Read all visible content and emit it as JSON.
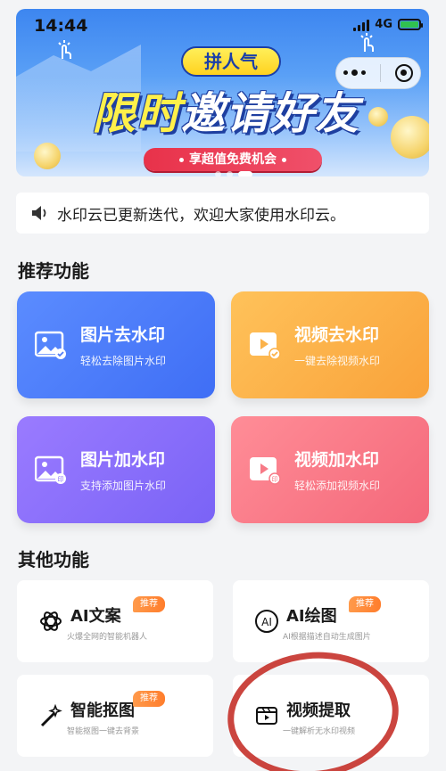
{
  "status_bar": {
    "time": "14:44",
    "network": "4G"
  },
  "banner": {
    "badge": "拼人气",
    "title_highlight": "限时",
    "title_rest": "邀请好友",
    "pill_text": "享超值免费机会"
  },
  "notice": {
    "text": "水印云已更新迭代，欢迎大家使用水印云。"
  },
  "recommended": {
    "title": "推荐功能",
    "cards": [
      {
        "title": "图片去水印",
        "subtitle": "轻松去除图片水印",
        "icon": "image-remove-icon",
        "color": "#4f7df8"
      },
      {
        "title": "视频去水印",
        "subtitle": "一键去除视频水印",
        "icon": "video-remove-icon",
        "color": "#fbb24a"
      },
      {
        "title": "图片加水印",
        "subtitle": "支持添加图片水印",
        "icon": "image-add-icon",
        "color": "#8a6ffb"
      },
      {
        "title": "视频加水印",
        "subtitle": "轻松添加视频水印",
        "icon": "video-add-icon",
        "color": "#f77a87"
      }
    ]
  },
  "other": {
    "title": "其他功能",
    "cards": [
      {
        "title": "AI文案",
        "subtitle": "火爆全网的智能机器人",
        "tag": "推荐",
        "icon": "openai-icon"
      },
      {
        "title": "AI绘图",
        "subtitle": "AI根据描述自动生成图片",
        "tag": "推荐",
        "icon": "ai-circle-icon"
      },
      {
        "title": "智能抠图",
        "subtitle": "智能抠图一键去背景",
        "tag": "推荐",
        "icon": "magic-wand-icon"
      },
      {
        "title": "视频提取",
        "subtitle": "一键解析无水印视频",
        "tag": "",
        "icon": "video-clip-icon"
      }
    ]
  },
  "colors": {
    "accent_blue": "#3f6ef5",
    "tag_orange": "#ff7d2c",
    "annotation_red": "#c5312a"
  }
}
